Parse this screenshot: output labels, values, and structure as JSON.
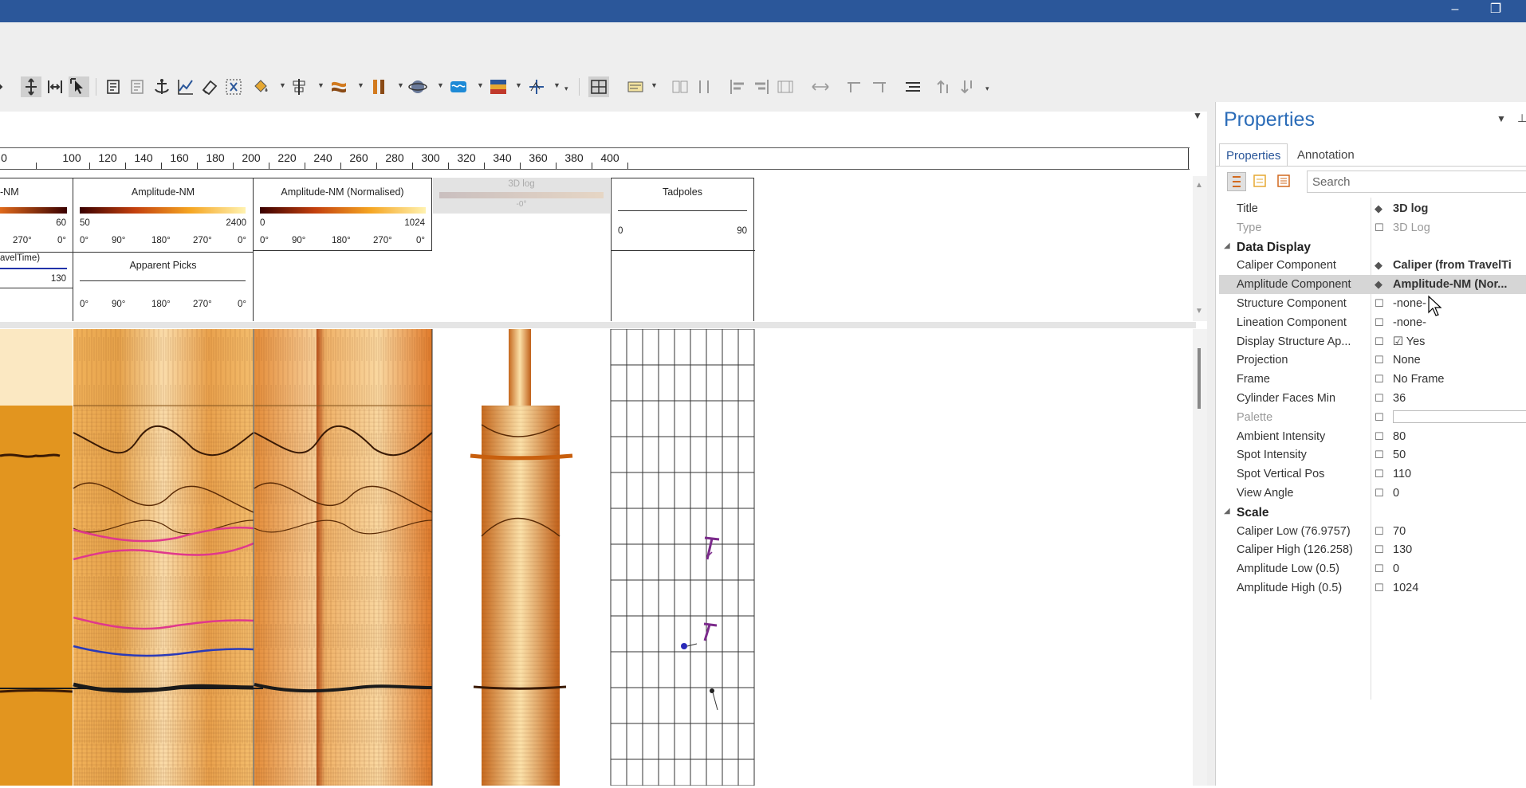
{
  "window": {
    "minimize": "–",
    "restore": "❐"
  },
  "toolbar": {
    "icons": [
      "pan-icon",
      "fit-icon",
      "select-icon",
      "edit-log-icon",
      "edit-template-icon",
      "anchor-icon",
      "line-chart-icon",
      "eraser-icon",
      "pick-icon",
      "paint-bucket-icon",
      "align-icon",
      "layers-icon",
      "columns-icon",
      "globe-icon",
      "wave-icon",
      "image-palette-icon",
      "crossplot-icon",
      "grid-layout-icon",
      "header-icon",
      "distribute-icon",
      "align-left-icon",
      "align-right-icon",
      "align-center-icon",
      "resize-icon",
      "move-up-icon",
      "move-down-icon",
      "list-icon",
      "sort-up-icon",
      "sort-down-icon"
    ]
  },
  "ruler": {
    "labels": [
      "0",
      "100",
      "120",
      "140",
      "160",
      "180",
      "200",
      "220",
      "240",
      "260",
      "280",
      "300",
      "320",
      "340",
      "360",
      "380",
      "400"
    ]
  },
  "tracks": {
    "t1": {
      "title": "-NM",
      "scale_right": "60",
      "deg": [
        "270°",
        "0°"
      ],
      "sub_title": "avelTime)",
      "sub_val": "130"
    },
    "t2": {
      "title": "Amplitude-NM",
      "scale_left": "50",
      "scale_right": "2400",
      "deg": [
        "0°",
        "90°",
        "180°",
        "270°",
        "0°"
      ],
      "sub_title": "Apparent Picks",
      "sub_deg": [
        "0°",
        "90°",
        "180°",
        "270°",
        "0°"
      ]
    },
    "t3": {
      "title": "Amplitude-NM (Normalised)",
      "scale_left": "0",
      "scale_right": "1024",
      "deg": [
        "0°",
        "90°",
        "180°",
        "270°",
        "0°"
      ]
    },
    "t4": {
      "title": "3D log",
      "sub": "-0°"
    },
    "t5": {
      "title": "Tadpoles",
      "scale_left": "0",
      "scale_right": "90"
    }
  },
  "properties": {
    "title": "Properties",
    "tabs": [
      "Properties",
      "Annotation"
    ],
    "search_placeholder": "Search",
    "rows": [
      {
        "name": "Title",
        "icon": "◆",
        "value": "3D log",
        "style": "bold"
      },
      {
        "name": "Type",
        "icon": "☐",
        "value": "3D Log",
        "style": "grey"
      },
      {
        "name": "Data Display",
        "icon": "",
        "value": "",
        "style": "sect"
      },
      {
        "name": "Caliper Component",
        "icon": "◆",
        "value": "Caliper (from TravelTi",
        "style": "bold"
      },
      {
        "name": "Amplitude Component",
        "icon": "◆",
        "value": "Amplitude-NM (Nor...",
        "style": "bold-sel"
      },
      {
        "name": "Structure Component",
        "icon": "☐",
        "value": "-none-",
        "style": ""
      },
      {
        "name": "Lineation Component",
        "icon": "☐",
        "value": "-none-",
        "style": ""
      },
      {
        "name": "Display Structure Ap...",
        "icon": "☐",
        "value": "☑ Yes",
        "style": ""
      },
      {
        "name": "Projection",
        "icon": "☐",
        "value": "None",
        "style": ""
      },
      {
        "name": "Frame",
        "icon": "☐",
        "value": "No Frame",
        "style": ""
      },
      {
        "name": "Cylinder Faces Min",
        "icon": "☐",
        "value": "36",
        "style": ""
      },
      {
        "name": "Palette",
        "icon": "☐",
        "value": "",
        "style": "grey"
      },
      {
        "name": "Ambient Intensity",
        "icon": "☐",
        "value": "80",
        "style": ""
      },
      {
        "name": "Spot Intensity",
        "icon": "☐",
        "value": "50",
        "style": ""
      },
      {
        "name": "Spot Vertical Pos",
        "icon": "☐",
        "value": "110",
        "style": ""
      },
      {
        "name": "View Angle",
        "icon": "☐",
        "value": "0",
        "style": ""
      },
      {
        "name": "Scale",
        "icon": "",
        "value": "",
        "style": "sect"
      },
      {
        "name": "Caliper Low (76.9757)",
        "icon": "☐",
        "value": "70",
        "style": ""
      },
      {
        "name": "Caliper High (126.258)",
        "icon": "☐",
        "value": "130",
        "style": ""
      },
      {
        "name": "Amplitude Low (0.5)",
        "icon": "☐",
        "value": "0",
        "style": ""
      },
      {
        "name": "Amplitude High (0.5)",
        "icon": "☐",
        "value": "1024",
        "style": ""
      }
    ]
  }
}
